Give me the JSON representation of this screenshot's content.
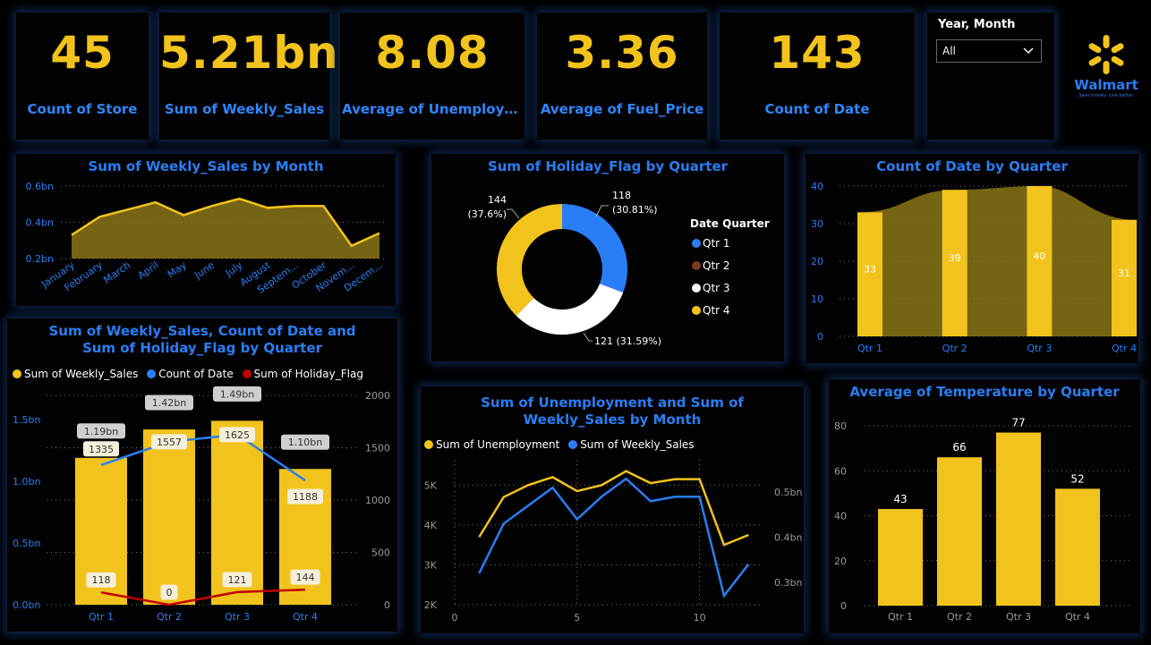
{
  "cards": [
    {
      "value": "45",
      "label": "Count of Store"
    },
    {
      "value": "5.21bn",
      "label": "Sum of Weekly_Sales"
    },
    {
      "value": "8.08",
      "label": "Average of Unemploym..."
    },
    {
      "value": "3.36",
      "label": "Average of Fuel_Price"
    },
    {
      "value": "143",
      "label": "Count of Date"
    }
  ],
  "slicer": {
    "label": "Year, Month",
    "value": "All"
  },
  "logo": {
    "name": "Walmart",
    "tagline": "Save money. Live better."
  },
  "colors": {
    "gold": "#f2c31c",
    "blue": "#2a7ef5",
    "dark_gold": "#8a7516",
    "red": "#c00000",
    "brown": "#7b3a22",
    "white": "#ffffff"
  },
  "chart_data": [
    {
      "id": "sales_by_month",
      "type": "area",
      "title": "Sum of Weekly_Sales by Month",
      "categories": [
        "January",
        "February",
        "March",
        "April",
        "May",
        "June",
        "July",
        "August",
        "Septem...",
        "October",
        "Novem...",
        "Decem..."
      ],
      "values": [
        0.33,
        0.43,
        0.47,
        0.51,
        0.44,
        0.49,
        0.53,
        0.48,
        0.49,
        0.49,
        0.27,
        0.34
      ],
      "y_ticks": [
        "0.6bn",
        "0.4bn",
        "0.2bn"
      ],
      "ylim": [
        0.2,
        0.6
      ]
    },
    {
      "id": "holiday_by_quarter",
      "type": "pie",
      "title": "Sum of Holiday_Flag by Quarter",
      "legend_title": "Date Quarter",
      "slices": [
        {
          "name": "Qtr 1",
          "value": 118,
          "label_value": "118",
          "label_pct": "(30.81%)",
          "color": "#2a7ef5"
        },
        {
          "name": "Qtr 2",
          "value": 0,
          "label_value": "",
          "label_pct": "",
          "color": "#7b3a22"
        },
        {
          "name": "Qtr 3",
          "value": 121,
          "label_value": "121 (31.59%)",
          "label_pct": "",
          "color": "#ffffff"
        },
        {
          "name": "Qtr 4",
          "value": 144,
          "label_value": "144",
          "label_pct": "(37.6%)",
          "color": "#f2c31c"
        }
      ]
    },
    {
      "id": "date_count_by_quarter",
      "type": "bar",
      "title": "Count of Date by Quarter",
      "categories": [
        "Qtr 1",
        "Qtr 2",
        "Qtr 3",
        "Qtr 4"
      ],
      "values": [
        33,
        39,
        40,
        31
      ],
      "y_ticks": [
        "40",
        "30",
        "20",
        "10",
        "0"
      ],
      "ylim": [
        0,
        40
      ]
    },
    {
      "id": "combo_by_quarter",
      "type": "bar",
      "title": "Sum of Weekly_Sales, Count of Date and Sum of Holiday_Flag by Quarter",
      "categories": [
        "Qtr 1",
        "Qtr 2",
        "Qtr 3",
        "Qtr 4"
      ],
      "series": [
        {
          "name": "Sum of Weekly_Sales",
          "values": [
            1.19,
            1.42,
            1.49,
            1.1
          ],
          "labels": [
            "1.19bn",
            "1.42bn",
            "1.49bn",
            "1.10bn"
          ],
          "color": "#f2c31c"
        },
        {
          "name": "Count of Date",
          "values": [
            1335,
            1557,
            1625,
            1188
          ],
          "labels": [
            "1335",
            "1557",
            "1625",
            "1188"
          ],
          "color": "#2a7ef5"
        },
        {
          "name": "Sum of Holiday_Flag",
          "values": [
            118,
            0,
            121,
            144
          ],
          "labels": [
            "118",
            "0",
            "121",
            "144"
          ],
          "color": "#c00000"
        }
      ],
      "y_ticks_left": [
        "1.5bn",
        "1.0bn",
        "0.5bn",
        "0.0bn"
      ],
      "y_ticks_right": [
        "2000",
        "1500",
        "1000",
        "500",
        "0"
      ],
      "ylim_left": [
        0,
        1.5
      ],
      "ylim_right": [
        0,
        2000
      ]
    },
    {
      "id": "unemployment_sales_by_month",
      "type": "line",
      "title": "Sum of Unemployment and Sum of Weekly_Sales by Month",
      "x": [
        1,
        2,
        3,
        4,
        5,
        6,
        7,
        8,
        9,
        10,
        11,
        12
      ],
      "series": [
        {
          "name": "Sum of Unemployment",
          "values": [
            3700,
            4700,
            5000,
            5200,
            4850,
            5000,
            5350,
            5050,
            5150,
            5150,
            3500,
            3750
          ],
          "color": "#f2c31c"
        },
        {
          "name": "Sum of Weekly_Sales",
          "values": [
            0.32,
            0.43,
            0.47,
            0.51,
            0.44,
            0.49,
            0.53,
            0.48,
            0.49,
            0.49,
            0.27,
            0.34
          ],
          "color": "#2a7ef5"
        }
      ],
      "x_ticks": [
        "0",
        "5",
        "10"
      ],
      "y_ticks_left": [
        "5K",
        "4K",
        "3K",
        "2K"
      ],
      "y_ticks_right": [
        "0.5bn",
        "0.4bn",
        "0.3bn"
      ],
      "xlim": [
        0,
        12.5
      ],
      "ylim_left": [
        2000,
        5500
      ],
      "ylim_right": [
        0.25,
        0.56
      ]
    },
    {
      "id": "temperature_by_quarter",
      "type": "bar",
      "title": "Average of Temperature by Quarter",
      "categories": [
        "Qtr 1",
        "Qtr 2",
        "Qtr 3",
        "Qtr 4"
      ],
      "values": [
        43,
        66,
        77,
        52
      ],
      "y_ticks": [
        "80",
        "60",
        "40",
        "20",
        "0"
      ],
      "ylim": [
        0,
        80
      ]
    }
  ]
}
